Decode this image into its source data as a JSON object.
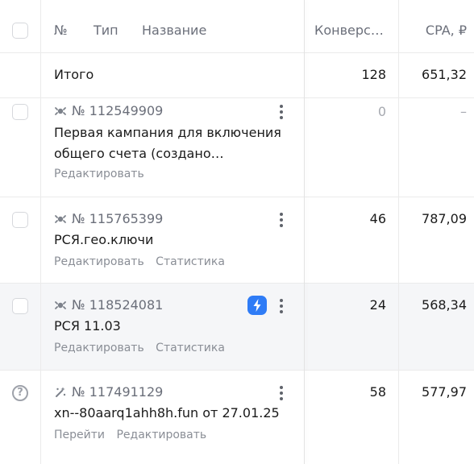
{
  "header": {
    "num_label": "№",
    "type_label": "Тип",
    "name_label": "Название",
    "conversions_label": "Конверс…",
    "cpa_label": "CPA, ₽"
  },
  "total": {
    "label": "Итого",
    "conversions": "128",
    "cpa": "651,32"
  },
  "rows": [
    {
      "id": "№ 112549909",
      "name": "Первая кампания для включения общего счета (создано…",
      "actions": [
        "Редактировать"
      ],
      "conversions": "0",
      "cpa": "–",
      "type_icon": "network-campaign-icon"
    },
    {
      "id": "№ 115765399",
      "name": "РСЯ.гео.ключи",
      "actions": [
        "Редактировать",
        "Статистика"
      ],
      "conversions": "46",
      "cpa": "787,09",
      "type_icon": "network-campaign-icon"
    },
    {
      "id": "№ 118524081",
      "name": "РСЯ 11.03",
      "actions": [
        "Редактировать",
        "Статистика"
      ],
      "conversions": "24",
      "cpa": "568,34",
      "type_icon": "network-campaign-icon",
      "badge_icon": "lightning-icon"
    },
    {
      "id": "№ 117491129",
      "name": "xn--80aarq1ahh8h.fun от 27.01.25",
      "actions": [
        "Перейти",
        "Редактировать"
      ],
      "conversions": "58",
      "cpa": "577,97",
      "type_icon": "magic-campaign-icon",
      "status_icon": "question-icon"
    }
  ],
  "colors": {
    "accent": "#2f7cf6",
    "muted_text": "#6b6f7a",
    "border": "#ebebeb",
    "highlight_row": "#f5f6f8"
  }
}
